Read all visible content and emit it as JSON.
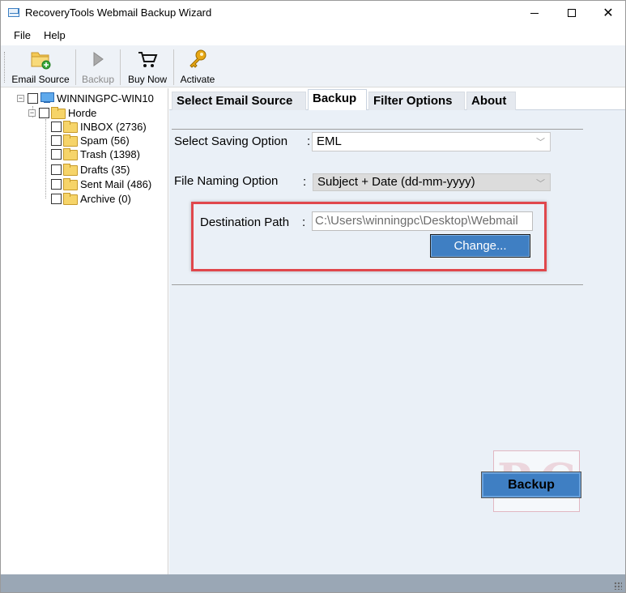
{
  "window": {
    "title": "RecoveryTools Webmail Backup Wizard"
  },
  "menu": {
    "file": "File",
    "help": "Help"
  },
  "toolbar": {
    "email_source": "Email Source",
    "backup": "Backup",
    "buy_now": "Buy Now",
    "activate": "Activate"
  },
  "tree": {
    "root": "WINNINGPC-WIN10",
    "account": "Horde",
    "folders": [
      {
        "label": "INBOX (2736)",
        "icon": "inbox-folder-icon"
      },
      {
        "label": "Spam (56)",
        "icon": "folder-icon"
      },
      {
        "label": "Trash (1398)",
        "icon": "trash-folder-icon"
      },
      {
        "label": "Drafts (35)",
        "icon": "drafts-folder-icon"
      },
      {
        "label": "Sent Mail (486)",
        "icon": "sent-folder-icon"
      },
      {
        "label": "Archive (0)",
        "icon": "folder-icon"
      }
    ]
  },
  "tabs": [
    {
      "label": "Select Email Source"
    },
    {
      "label": "Backup",
      "active": true
    },
    {
      "label": "Filter Options"
    },
    {
      "label": "About"
    }
  ],
  "backup_panel": {
    "saving_option_label": "Select Saving Option",
    "saving_option_value": "EML",
    "naming_option_label": "File Naming Option",
    "naming_option_value": "Subject + Date (dd-mm-yyyy)",
    "destination_label": "Destination Path",
    "destination_value": "C:\\Users\\winningpc\\Desktop\\Webmail",
    "change_button": "Change...",
    "backup_button": "Backup",
    "colon": ":"
  },
  "colors": {
    "accent_button": "#3f7fc3",
    "highlight": "#e0474c",
    "panel_bg": "#eaf0f7",
    "statusbar": "#9aa7b5"
  }
}
